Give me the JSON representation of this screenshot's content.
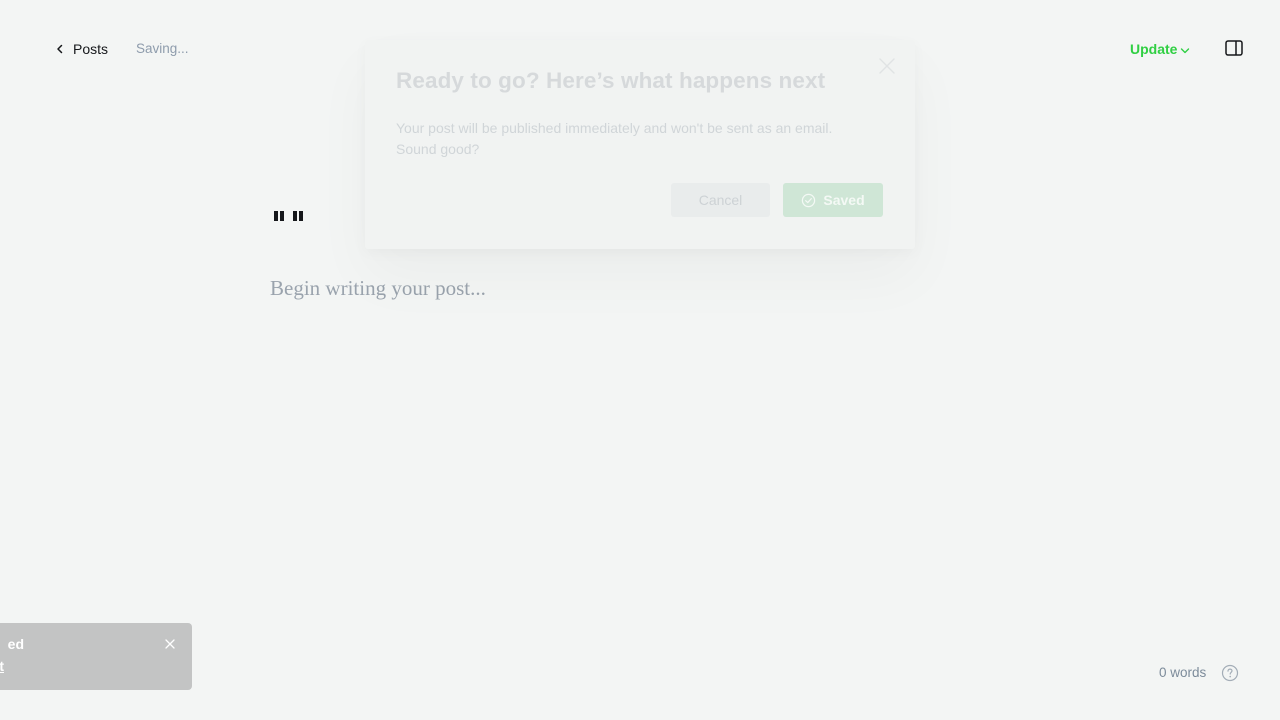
{
  "header": {
    "back_label": "Posts",
    "status": "Saving...",
    "update_label": "Update"
  },
  "editor": {
    "title_glyph": "\"\"",
    "placeholder": "Begin writing your post..."
  },
  "modal": {
    "title": "Ready to go? Here’s what happens next",
    "body_line1": "Your post will be published immediately and won't be sent as an email.",
    "body_line2": "Sound good?",
    "cancel_label": "Cancel",
    "confirm_label": "Saved"
  },
  "toast": {
    "message_fragment": "ed",
    "link_fragment": "t"
  },
  "footer": {
    "word_count": "0 words"
  },
  "colors": {
    "accent_green": "#30cf43",
    "background": "#f3f5f4",
    "muted_text": "#8e9cac"
  },
  "icons": [
    "chevron-left-icon",
    "chevron-down-icon",
    "sidebar-toggle-icon",
    "close-icon",
    "check-circle-icon",
    "help-icon"
  ]
}
